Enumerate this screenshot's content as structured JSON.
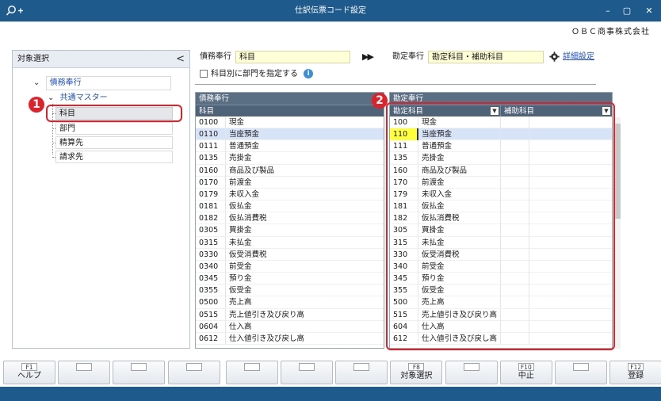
{
  "window": {
    "title": "仕訳伝票コード設定",
    "company": "ＯＢＣ商事株式会社",
    "controls": [
      "minimize-icon",
      "maximize-icon",
      "close-icon"
    ]
  },
  "left_panel": {
    "title": "対象選択",
    "collapse_glyph": "<",
    "tree": {
      "root_label": "債務奉行",
      "group_label": "共通マスター",
      "items": [
        "科目",
        "部門",
        "精算先",
        "請求先"
      ]
    }
  },
  "form": {
    "source_label": "債務奉行",
    "source_value": "科目",
    "arrow_glyph": "▶▶",
    "target_label": "勘定奉行",
    "target_value": "勘定科目・補助科目",
    "settings_link": "詳細設定",
    "checkbox_label": "科目別に部門を指定する",
    "info_glyph": "i"
  },
  "left_grid": {
    "title": "債務奉行",
    "column": "科目",
    "rows": [
      [
        "0100",
        "現金"
      ],
      [
        "0110",
        "当座預金"
      ],
      [
        "0111",
        "普通預金"
      ],
      [
        "0135",
        "売掛金"
      ],
      [
        "0160",
        "商品及び製品"
      ],
      [
        "0170",
        "前渡金"
      ],
      [
        "0179",
        "未収入金"
      ],
      [
        "0181",
        "仮払金"
      ],
      [
        "0182",
        "仮払消費税"
      ],
      [
        "0305",
        "買掛金"
      ],
      [
        "0315",
        "未払金"
      ],
      [
        "0330",
        "仮受消費税"
      ],
      [
        "0340",
        "前受金"
      ],
      [
        "0345",
        "預り金"
      ],
      [
        "0355",
        "仮受金"
      ],
      [
        "0500",
        "売上高"
      ],
      [
        "0515",
        "売上値引き及び戻り高"
      ],
      [
        "0604",
        "仕入高"
      ],
      [
        "0612",
        "仕入値引き及び戻し高"
      ]
    ]
  },
  "right_grid": {
    "title": "勘定奉行",
    "col1": "勘定科目",
    "col2": "補助科目",
    "rows": [
      [
        "100",
        "現金"
      ],
      [
        "110",
        "当座預金"
      ],
      [
        "111",
        "普通預金"
      ],
      [
        "135",
        "売掛金"
      ],
      [
        "160",
        "商品及び製品"
      ],
      [
        "170",
        "前渡金"
      ],
      [
        "179",
        "未収入金"
      ],
      [
        "181",
        "仮払金"
      ],
      [
        "182",
        "仮払消費税"
      ],
      [
        "305",
        "買掛金"
      ],
      [
        "315",
        "未払金"
      ],
      [
        "330",
        "仮受消費税"
      ],
      [
        "340",
        "前受金"
      ],
      [
        "345",
        "預り金"
      ],
      [
        "355",
        "仮受金"
      ],
      [
        "500",
        "売上高"
      ],
      [
        "515",
        "売上値引き及び戻り高"
      ],
      [
        "604",
        "仕入高"
      ],
      [
        "612",
        "仕入値引き及び戻し高"
      ]
    ]
  },
  "selected_row": 1,
  "callouts": [
    "1",
    "2"
  ],
  "fkeys": [
    {
      "num": "F1",
      "label": "ヘルプ"
    },
    {
      "num": "",
      "label": ""
    },
    {
      "num": "",
      "label": ""
    },
    {
      "num": "",
      "label": ""
    },
    {
      "num": "",
      "label": ""
    },
    {
      "num": "",
      "label": ""
    },
    {
      "num": "",
      "label": ""
    },
    {
      "num": "F8",
      "label": "対象選択"
    },
    {
      "num": "",
      "label": ""
    },
    {
      "num": "F10",
      "label": "中止"
    },
    {
      "num": "",
      "label": ""
    },
    {
      "num": "F12",
      "label": "登録"
    }
  ],
  "colors": {
    "titlebar": "#1f5a8c",
    "callout": "#e0212a",
    "link": "#1f4fc4",
    "selected_row": "#d7e3f7",
    "input_yellow": "#ffffd7"
  }
}
